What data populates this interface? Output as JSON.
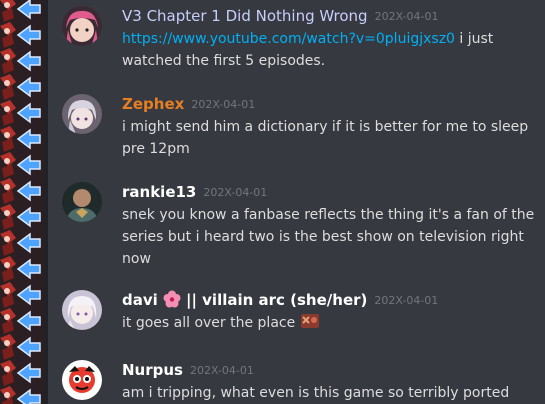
{
  "messages": [
    {
      "author": "V3 Chapter 1 Did Nothing Wrong",
      "author_color": "#c9cdfb",
      "timestamp": "202X-04-01",
      "link": "https://www.youtube.com/watch?v=0pluigjxsz0",
      "text": " i just watched the first 5 episodes.",
      "avatar_icon": "avatar-pink-hair-icon"
    },
    {
      "author": "Zephex",
      "author_color": "#e67e22",
      "timestamp": "202X-04-01",
      "text": "i might send him a dictionary if it is better for me to sleep pre 12pm",
      "avatar_icon": "avatar-silver-hair-icon"
    },
    {
      "author": "rankie13",
      "author_color": "#ffffff",
      "timestamp": "202X-04-01",
      "text": "snek you know a fanbase reflects the thing it's a fan of the series but i heard two is the best show on television right now",
      "avatar_icon": "avatar-armored-man-icon"
    },
    {
      "author": "davi",
      "author_suffix": "|| villain arc (she/her)",
      "author_emoji": "hibiscus-emoji",
      "author_color": "#ffffff",
      "timestamp": "202X-04-01",
      "text": "it goes all over the place",
      "trailing_emoji": "reaction-emoji",
      "avatar_icon": "avatar-white-hair-icon"
    },
    {
      "author": "Nurpus",
      "author_color": "#ffffff",
      "timestamp": "202X-04-01",
      "text": "am i tripping, what even is this game so terribly ported",
      "avatar_icon": "avatar-cartoon-icon"
    }
  ],
  "colors": {
    "background": "#36393f",
    "timestamp": "#72767d",
    "text": "#dcddde",
    "link": "#00b0f4"
  }
}
